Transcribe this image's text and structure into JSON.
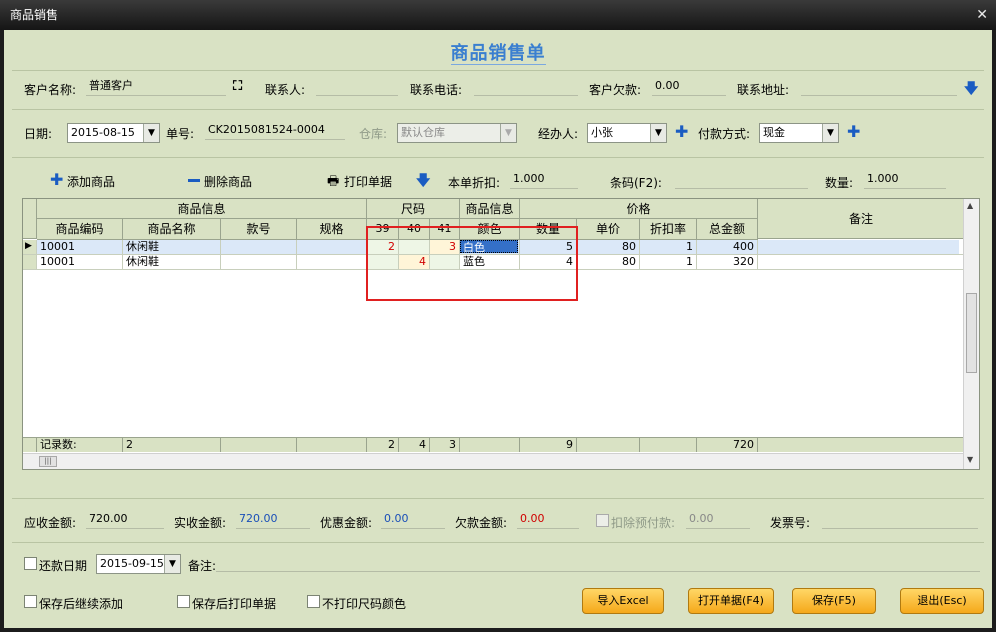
{
  "window": {
    "title": "商品销售",
    "form_title": "商品销售单"
  },
  "customer": {
    "name_label": "客户名称:",
    "name_value": "普通客户",
    "contact_label": "联系人:",
    "contact_value": "",
    "phone_label": "联系电话:",
    "phone_value": "",
    "debt_label": "客户欠款:",
    "debt_value": "0.00",
    "address_label": "联系地址:",
    "address_value": ""
  },
  "order": {
    "date_label": "日期:",
    "date_value": "2015-08-15",
    "no_label": "单号:",
    "no_value": "CK2015081524-0004",
    "warehouse_label": "仓库:",
    "warehouse_value": "默认仓库",
    "handler_label": "经办人:",
    "handler_value": "小张",
    "payment_label": "付款方式:",
    "payment_value": "现金"
  },
  "toolbar": {
    "add_label": "添加商品",
    "delete_label": "删除商品",
    "print_label": "打印单据",
    "discount_label": "本单折扣:",
    "discount_value": "1.000",
    "barcode_label": "条码(F2):",
    "barcode_value": "",
    "qty_label": "数量:",
    "qty_value": "1.000"
  },
  "grid": {
    "group_headers": {
      "product_info": "商品信息",
      "size": "尺码",
      "product_info2": "商品信息",
      "price": "价格",
      "remark": "备注"
    },
    "columns": {
      "code": "商品编码",
      "name": "商品名称",
      "style": "款号",
      "spec": "规格",
      "s39": "39",
      "s40": "40",
      "s41": "41",
      "color": "颜色",
      "qty": "数量",
      "unit_price": "单价",
      "discount": "折扣率",
      "total": "总金额"
    },
    "rows": [
      {
        "code": "10001",
        "name": "休闲鞋",
        "style": "",
        "spec": "",
        "s39": "2",
        "s40": "",
        "s41": "3",
        "color": "白色",
        "qty": "5",
        "unit_price": "80",
        "discount": "1",
        "total": "400"
      },
      {
        "code": "10001",
        "name": "休闲鞋",
        "style": "",
        "spec": "",
        "s39": "",
        "s40": "4",
        "s41": "",
        "color": "蓝色",
        "qty": "4",
        "unit_price": "80",
        "discount": "1",
        "total": "320"
      }
    ],
    "footer": {
      "label": "记录数:",
      "count": "2",
      "s39": "2",
      "s40": "4",
      "s41": "3",
      "qty": "9",
      "total": "720"
    }
  },
  "summary": {
    "receivable_label": "应收金额:",
    "receivable_value": "720.00",
    "received_label": "实收金额:",
    "received_value": "720.00",
    "discount_label": "优惠金额:",
    "discount_value": "0.00",
    "owed_label": "欠款金额:",
    "owed_value": "0.00",
    "prepaid_label": "扣除预付款:",
    "prepaid_value": "0.00",
    "invoice_label": "发票号:",
    "invoice_value": ""
  },
  "repay": {
    "label": "还款日期",
    "date_value": "2015-09-15",
    "remark_label": "备注:",
    "remark_value": ""
  },
  "options": {
    "continue_add": "保存后继续添加",
    "print_after": "保存后打印单据",
    "no_print_size": "不打印尺码颜色"
  },
  "buttons": {
    "import_excel": "导入Excel",
    "open_doc": "打开单据(F4)",
    "save": "保存(F5)",
    "exit": "退出(Esc)"
  },
  "colors": {
    "accent": "#1a5cc2",
    "title": "#3a7fd0",
    "panel": "#d9e2c4",
    "button": "#f5a81a",
    "highlight": "#e02020"
  }
}
